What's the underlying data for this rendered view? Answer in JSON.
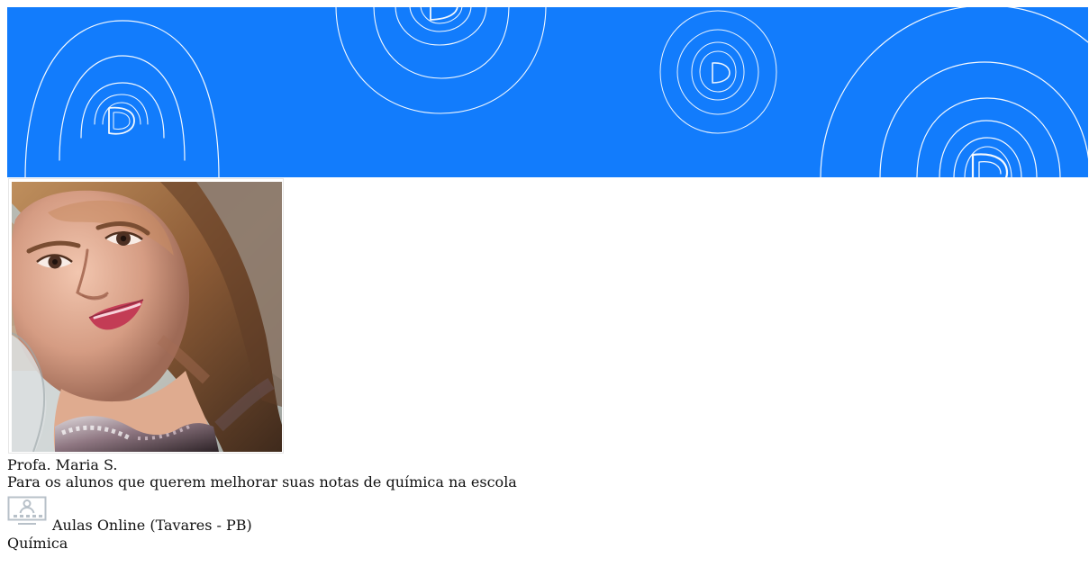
{
  "banner": {
    "background_color": "#127cfc",
    "pattern_icon": "concentric-d-logo-pattern"
  },
  "teacher": {
    "photo_icon": "teacher-portrait-photo",
    "name": "Profa. Maria S.",
    "headline": "Para os alunos que querem melhorar suas notas de química na escola",
    "lesson_icon": "online-lesson-monitor-icon",
    "lesson_type": "Aulas Online (Tavares - PB)",
    "subject": "Química"
  },
  "colors": {
    "icon_gray": "#b8c1c9",
    "text": "#111111"
  }
}
